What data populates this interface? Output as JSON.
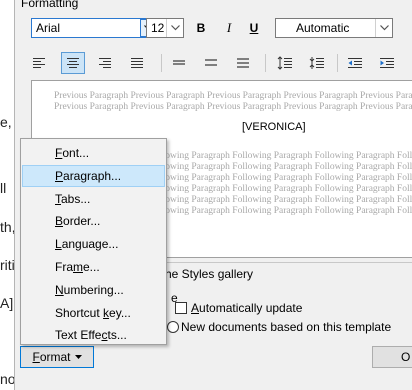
{
  "background_text": {
    "line1": "e,",
    "line2": "ll",
    "line3": "th,",
    "line4": "riti",
    "line5": "A]",
    "line6": "now!"
  },
  "dialog": {
    "group_title": "Formatting",
    "font_name": "Arial",
    "font_size": "12",
    "bold_label": "B",
    "italic_label": "I",
    "underline_label": "U",
    "color_value": "Automatic",
    "preview": {
      "previous_line": "Previous Paragraph Previous Paragraph Previous Paragraph Previous Paragraph Previous Paragraph Previous Paragraph",
      "previous_line2": "Previous Paragraph Previous Paragraph Previous Paragraph Previous Paragraph Previous Paragraph Previous Paragraph",
      "current_text": "[VERONICA]",
      "following_line": "llowing Paragraph Following Paragraph Following Paragraph Following Paragraph Following Paragraph Followi"
    },
    "add_to_gallery_fragment": "he Styles gallery",
    "fragment_e": "e",
    "auto_update_label": "Automatically update",
    "new_docs_label": "New documents based on this template",
    "format_button": "Format",
    "ok_fragment": "O",
    "colors": {
      "accent": "#0078d7",
      "menu_hover": "#cde8fb",
      "active_align": "#cce4f7"
    }
  },
  "format_menu": {
    "items": [
      {
        "pre": "",
        "key": "F",
        "post": "ont..."
      },
      {
        "pre": "",
        "key": "P",
        "post": "aragraph..."
      },
      {
        "pre": "",
        "key": "T",
        "post": "abs..."
      },
      {
        "pre": "",
        "key": "B",
        "post": "order..."
      },
      {
        "pre": "",
        "key": "L",
        "post": "anguage..."
      },
      {
        "pre": "Fra",
        "key": "m",
        "post": "e..."
      },
      {
        "pre": "",
        "key": "N",
        "post": "umbering..."
      },
      {
        "pre": "Shortcut ",
        "key": "k",
        "post": "ey..."
      },
      {
        "pre": "Text Effe",
        "key": "c",
        "post": "ts..."
      }
    ],
    "hovered_index": 1
  }
}
